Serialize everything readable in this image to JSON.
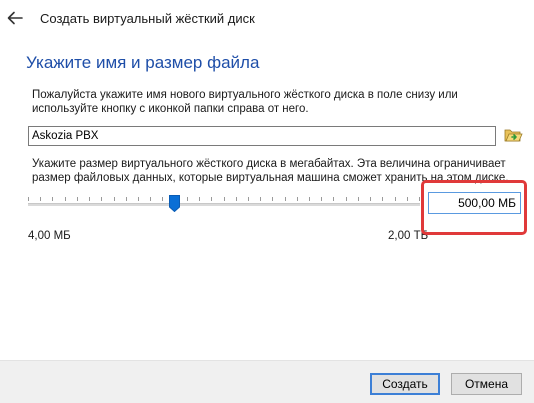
{
  "window": {
    "title": "Создать виртуальный жёсткий диск"
  },
  "page": {
    "heading": "Укажите имя и размер файла",
    "name_description": "Пожалуйста укажите имя нового виртуального жёсткого диска в поле снизу или используйте кнопку с иконкой папки справа от него.",
    "name_value": "Askozia PBX",
    "size_description": "Укажите размер виртуального жёсткого диска в мегабайтах. Эта величина ограничивает размер файловых данных, которые виртуальная машина сможет хранить на этом диске.",
    "size_value": "500,00 МБ",
    "slider_fraction": 0.37,
    "slider_min_label": "4,00 МБ",
    "slider_max_label": "2,00 ТБ"
  },
  "footer": {
    "create_label": "Создать",
    "cancel_label": "Отмена"
  },
  "colors": {
    "heading": "#1e4ea8",
    "highlight": "#e0393a",
    "thumb": "#0a6fd6"
  },
  "icons": {
    "back": "arrow-left-icon",
    "folder": "folder-open-icon"
  }
}
